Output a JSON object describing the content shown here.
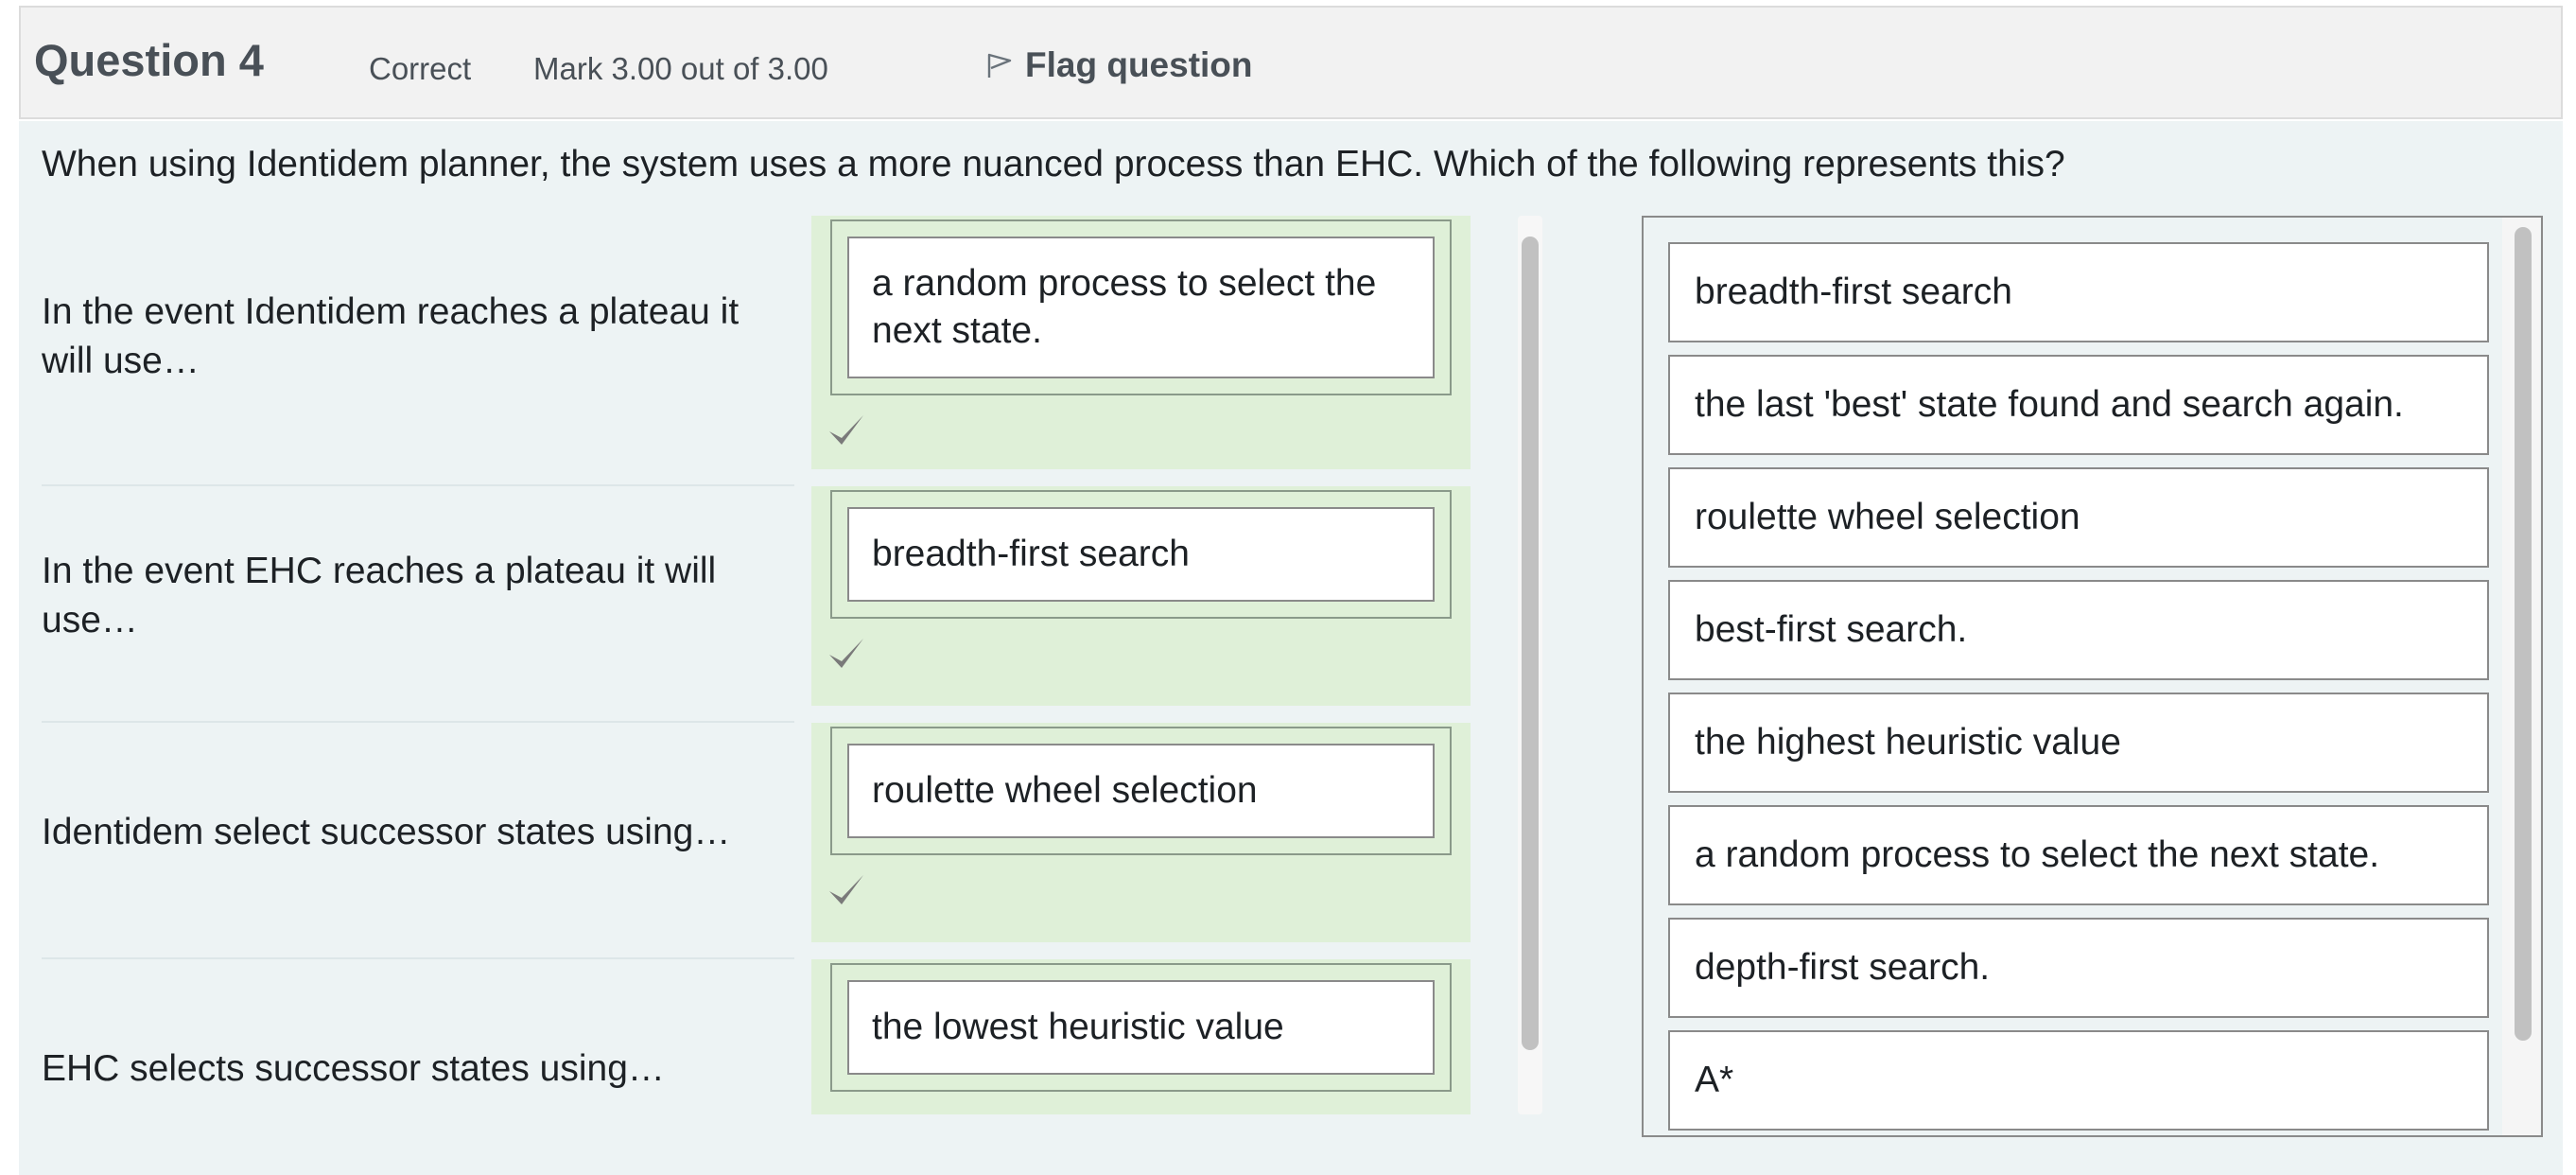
{
  "question": {
    "number_label": "Question 4",
    "state": "Correct",
    "grade": "Mark 3.00 out of 3.00",
    "flag_label": "Flag question",
    "text": "When using Identidem planner, the system uses a more nuanced process than EHC.  Which of the following represents this?"
  },
  "stems": [
    {
      "text": "In the event Identidem reaches a plateau it will use…",
      "answer": "a random process to select the next state.",
      "correct": true
    },
    {
      "text": "In the event EHC reaches a plateau it will use…",
      "answer": "breadth-first search",
      "correct": true
    },
    {
      "text": "Identidem select successor states using…",
      "answer": "roulette wheel selection",
      "correct": true
    },
    {
      "text": "EHC selects successor states using…",
      "answer": "the lowest heuristic value"
    }
  ],
  "choices": [
    "breadth-first search",
    "the last 'best' state found and search again.",
    "roulette wheel selection",
    "best-first search.",
    "the highest heuristic value",
    "a random process to select the next state.",
    "depth-first search.",
    "A*"
  ],
  "icons": {
    "flag": "flag-icon",
    "check": "check-icon"
  },
  "colors": {
    "correct_bg": "#dff0d8",
    "panel_bg": "#edf3f4",
    "header_bg": "#f2f2f2",
    "check": "#7a7a7a"
  }
}
